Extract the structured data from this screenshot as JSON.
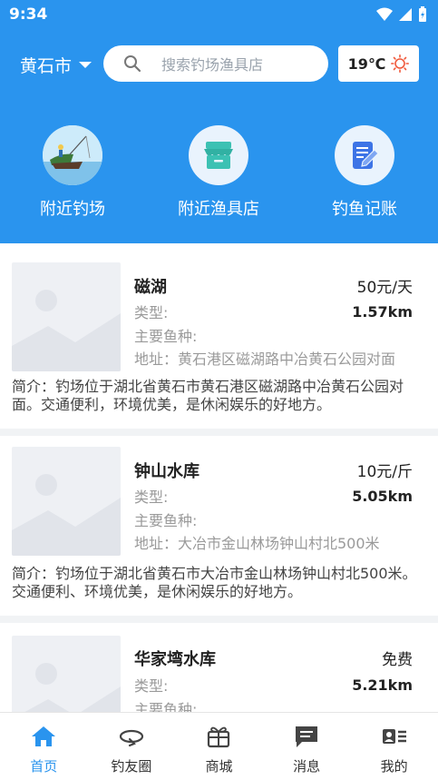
{
  "status": {
    "time": "9:34"
  },
  "header": {
    "city": "黄石市",
    "search_placeholder": "搜索钓场渔具店",
    "weather_temp": "19℃"
  },
  "quick_links": [
    {
      "label": "附近钓场",
      "icon": "fishing-boat-icon"
    },
    {
      "label": "附近渔具店",
      "icon": "shop-icon"
    },
    {
      "label": "钓鱼记账",
      "icon": "notebook-edit-icon"
    }
  ],
  "spots": [
    {
      "name": "磁湖",
      "price": "50元/天",
      "type_label": "类型:",
      "distance": "1.57km",
      "fish_label": "主要鱼种:",
      "address": "地址：黄石港区磁湖路中冶黄石公园对面",
      "intro": "简介：钓场位于湖北省黄石市黄石港区磁湖路中冶黄石公园对面。交通便利，环境优美，是休闲娱乐的好地方。"
    },
    {
      "name": "钟山水库",
      "price": "10元/斤",
      "type_label": "类型:",
      "distance": "5.05km",
      "fish_label": "主要鱼种:",
      "address": "地址：大冶市金山林场钟山村北500米",
      "intro": "简介：钓场位于湖北省黄石市大冶市金山林场钟山村北500米。交通便利、环境优美，是休闲娱乐的好地方。"
    },
    {
      "name": "华家塆水库",
      "price": "免费",
      "type_label": "类型:",
      "distance": "5.21km",
      "fish_label": "主要鱼种:"
    }
  ],
  "nav": [
    {
      "label": "首页",
      "icon": "home-icon",
      "active": true
    },
    {
      "label": "钓友圈",
      "icon": "fishing-circle-icon"
    },
    {
      "label": "商城",
      "icon": "gift-shop-icon"
    },
    {
      "label": "消息",
      "icon": "message-icon"
    },
    {
      "label": "我的",
      "icon": "profile-icon"
    }
  ],
  "colors": {
    "accent": "#2a94ee",
    "weather_sun": "#f0593b"
  }
}
